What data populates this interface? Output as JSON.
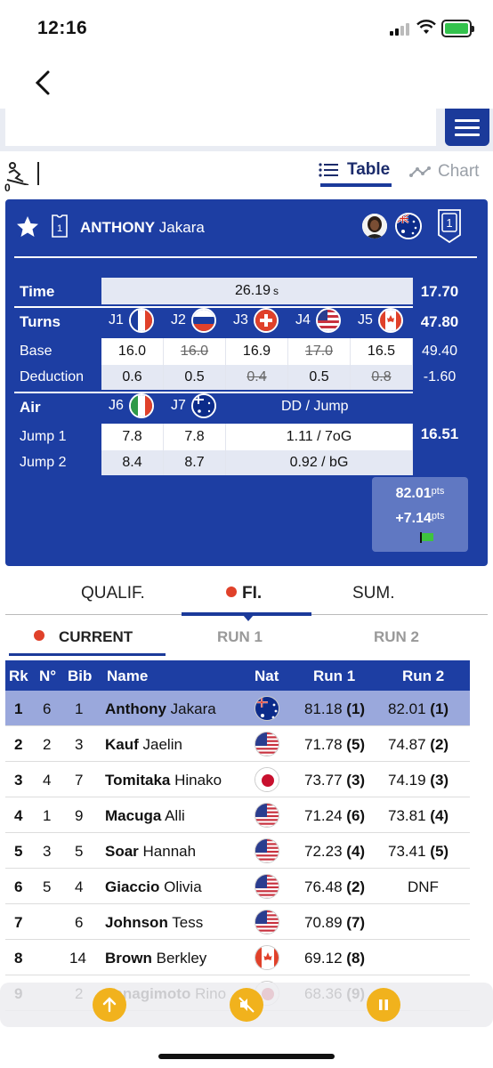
{
  "status": {
    "time": "12:16"
  },
  "tools": {
    "ski_count": "0",
    "table_label": "Table",
    "chart_label": "Chart"
  },
  "athlete": {
    "first": "Jakara",
    "last": "ANTHONY",
    "bib": "1",
    "rank": "1"
  },
  "score": {
    "time_label": "Time",
    "time_value": "26.19",
    "time_unit": "s",
    "time_points": "17.70",
    "turns_label": "Turns",
    "turns_points": "47.80",
    "judges": [
      "J1",
      "J2",
      "J3",
      "J4",
      "J5"
    ],
    "base_label": "Base",
    "base": [
      "16.0",
      "16.0",
      "16.9",
      "17.0",
      "16.5"
    ],
    "base_total": "49.40",
    "deduction_label": "Deduction",
    "deduction": [
      "0.6",
      "0.5",
      "0.4",
      "0.5",
      "0.8"
    ],
    "deduction_total": "-1.60",
    "air_label": "Air",
    "air_judges": [
      "J6",
      "J7"
    ],
    "dd_label": "DD / Jump",
    "air_points": "16.51",
    "jump1_label": "Jump 1",
    "jump1": [
      "7.8",
      "7.8",
      "1.11 / 7oG"
    ],
    "jump2_label": "Jump 2",
    "jump2": [
      "8.4",
      "8.7",
      "0.92 / bG"
    ],
    "total": "82.01",
    "diff": "+7.14",
    "pts": "pts"
  },
  "round_tabs": [
    "QUALIF.",
    "FI.",
    "SUM."
  ],
  "run_tabs": [
    "CURRENT",
    "RUN 1",
    "RUN 2"
  ],
  "table": {
    "headers": [
      "Rk",
      "N°",
      "Bib",
      "Name",
      "Nat",
      "Run 1",
      "Run 2"
    ],
    "rows": [
      {
        "rk": "1",
        "n": "6",
        "bib": "1",
        "last": "Anthony",
        "first": "Jakara",
        "nat": "AUS",
        "run1": "81.18",
        "run1_rk": "(1)",
        "run2": "82.01",
        "run2_rk": "(1)"
      },
      {
        "rk": "2",
        "n": "2",
        "bib": "3",
        "last": "Kauf",
        "first": "Jaelin",
        "nat": "USA",
        "run1": "71.78",
        "run1_rk": "(5)",
        "run2": "74.87",
        "run2_rk": "(2)"
      },
      {
        "rk": "3",
        "n": "4",
        "bib": "7",
        "last": "Tomitaka",
        "first": "Hinako",
        "nat": "JPN",
        "run1": "73.77",
        "run1_rk": "(3)",
        "run2": "74.19",
        "run2_rk": "(3)"
      },
      {
        "rk": "4",
        "n": "1",
        "bib": "9",
        "last": "Macuga",
        "first": "Alli",
        "nat": "USA",
        "run1": "71.24",
        "run1_rk": "(6)",
        "run2": "73.81",
        "run2_rk": "(4)"
      },
      {
        "rk": "5",
        "n": "3",
        "bib": "5",
        "last": "Soar",
        "first": "Hannah",
        "nat": "USA",
        "run1": "72.23",
        "run1_rk": "(4)",
        "run2": "73.41",
        "run2_rk": "(5)"
      },
      {
        "rk": "6",
        "n": "5",
        "bib": "4",
        "last": "Giaccio",
        "first": "Olivia",
        "nat": "USA",
        "run1": "76.48",
        "run1_rk": "(2)",
        "run2": "DNF",
        "run2_rk": ""
      },
      {
        "rk": "7",
        "n": "",
        "bib": "6",
        "last": "Johnson",
        "first": "Tess",
        "nat": "USA",
        "run1": "70.89",
        "run1_rk": "(7)",
        "run2": "",
        "run2_rk": ""
      },
      {
        "rk": "8",
        "n": "",
        "bib": "14",
        "last": "Brown",
        "first": "Berkley",
        "nat": "CAN",
        "run1": "69.12",
        "run1_rk": "(8)",
        "run2": "",
        "run2_rk": ""
      },
      {
        "rk": "9",
        "n": "",
        "bib": "2",
        "last": "Yanagimoto",
        "first": "Rino",
        "nat": "JPN",
        "run1": "68.36",
        "run1_rk": "(9)",
        "run2": "",
        "run2_rk": ""
      }
    ]
  },
  "player": {
    "icons": [
      "up-arrow-icon",
      "mute-icon",
      "pause-icon"
    ]
  }
}
